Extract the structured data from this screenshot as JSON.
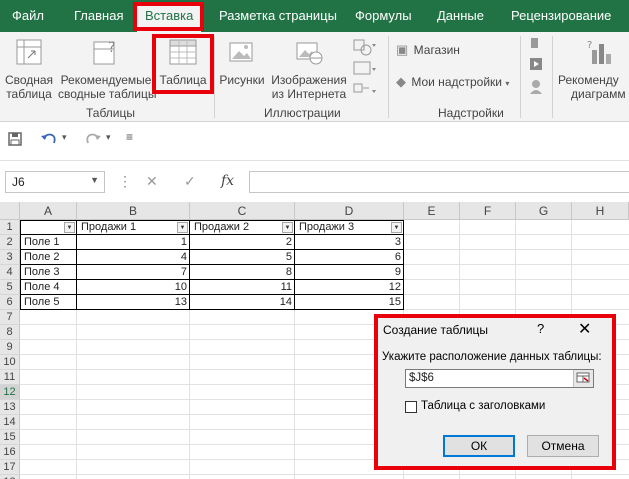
{
  "ribbon_tabs": [
    "Файл",
    "Главная",
    "Вставка",
    "Разметка страницы",
    "Формулы",
    "Данные",
    "Рецензирование"
  ],
  "active_tab": "Вставка",
  "ribbon": {
    "pivot_table": [
      "Сводная",
      "таблица"
    ],
    "recommended_pivot": [
      "Рекомендуемые",
      "сводные таблицы"
    ],
    "table": "Таблица",
    "group_tables": "Таблицы",
    "pictures": "Рисунки",
    "online_pictures": [
      "Изображения",
      "из Интернета"
    ],
    "group_illustrations": "Иллюстрации",
    "store": "Магазин",
    "my_addins": "Мои надстройки",
    "group_addins": "Надстройки",
    "recommended_charts": [
      "Рекоменду",
      "диаграмм"
    ]
  },
  "formula_bar": {
    "name_box": "J6",
    "fx": "fx",
    "value": ""
  },
  "sheet": {
    "columns": [
      "A",
      "B",
      "C",
      "D",
      "E",
      "F",
      "G",
      "H"
    ],
    "rows": [
      "1",
      "2",
      "3",
      "4",
      "5",
      "6",
      "7",
      "8",
      "9",
      "10",
      "11",
      "12",
      "13",
      "14",
      "15",
      "16",
      "17",
      "18"
    ],
    "selected_row": "12",
    "headers": [
      "",
      "Продажи 1",
      "Продажи 2",
      "Продажи 3"
    ],
    "data": [
      [
        "Поле 1",
        "1",
        "2",
        "3"
      ],
      [
        "Поле 2",
        "4",
        "5",
        "6"
      ],
      [
        "Поле 3",
        "7",
        "8",
        "9"
      ],
      [
        "Поле 4",
        "10",
        "11",
        "12"
      ],
      [
        "Поле 5",
        "13",
        "14",
        "15"
      ]
    ]
  },
  "dialog": {
    "title": "Создание таблицы",
    "help": "?",
    "close": "✕",
    "prompt": "Укажите расположение данных таблицы:",
    "range": "$J$6",
    "checkbox_label": "Таблица с заголовками",
    "checkbox_checked": false,
    "ok": "ОК",
    "cancel": "Отмена"
  },
  "colors": {
    "excel_green": "#217346",
    "highlight_red": "#e8000b"
  }
}
